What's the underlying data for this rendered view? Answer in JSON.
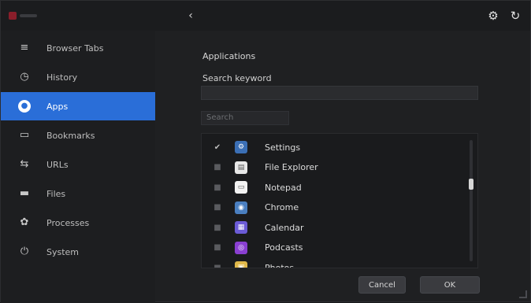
{
  "titlebar": {
    "back_symbol": "‹",
    "buttons": [
      {
        "icon": "gear-icon",
        "glyph": "⚙"
      },
      {
        "icon": "refresh-icon",
        "glyph": "↻"
      }
    ]
  },
  "sidebar": {
    "items": [
      {
        "id": "browser-tabs",
        "label": "Browser Tabs",
        "icon": "list-icon",
        "glyph": "≡",
        "active": false
      },
      {
        "id": "history",
        "label": "History",
        "icon": "history-icon",
        "glyph": "◷",
        "active": false
      },
      {
        "id": "apps",
        "label": "Apps",
        "icon": "apps-icon",
        "glyph": "●",
        "active": true
      },
      {
        "id": "bookmarks",
        "label": "Bookmarks",
        "icon": "bookmark-icon",
        "glyph": "▭",
        "active": false
      },
      {
        "id": "urls",
        "label": "URLs",
        "icon": "link-icon",
        "glyph": "⇆",
        "active": false
      },
      {
        "id": "files",
        "label": "Files",
        "icon": "folder-icon",
        "glyph": "▬",
        "active": false
      },
      {
        "id": "processes",
        "label": "Processes",
        "icon": "gear-icon",
        "glyph": "✿",
        "active": false
      },
      {
        "id": "system",
        "label": "System",
        "icon": "power-icon",
        "glyph": "⏻",
        "active": false
      }
    ]
  },
  "main": {
    "section_title": "Applications",
    "field_label": "Search keyword",
    "field_value": "",
    "filter_placeholder": "Search",
    "apps": [
      {
        "name": "Settings",
        "checked": true,
        "icon": "settings-app-icon",
        "color": "#3b6fb5",
        "glyph": "⚙"
      },
      {
        "name": "File Explorer",
        "checked": false,
        "icon": "explorer-app-icon",
        "color": "#e8e8e8",
        "glyph": "▤"
      },
      {
        "name": "Notepad",
        "checked": false,
        "icon": "notepad-app-icon",
        "color": "#f2f2f2",
        "glyph": "▭"
      },
      {
        "name": "Chrome",
        "checked": false,
        "icon": "browser-app-icon",
        "color": "#4a7fc0",
        "glyph": "◉"
      },
      {
        "name": "Calendar",
        "checked": false,
        "icon": "calendar-app-icon",
        "color": "#6b5bd6",
        "glyph": "▦"
      },
      {
        "name": "Podcasts",
        "checked": false,
        "icon": "podcast-app-icon",
        "color": "#8a3fd1",
        "glyph": "◎"
      },
      {
        "name": "Photos",
        "checked": false,
        "icon": "photos-app-icon",
        "color": "#e0b84a",
        "glyph": "▣"
      }
    ],
    "scroll_position": 0.35
  },
  "footer": {
    "cancel_label": "Cancel",
    "ok_label": "OK"
  },
  "colors": {
    "accent": "#2a6ed8",
    "background": "#1f2022"
  }
}
